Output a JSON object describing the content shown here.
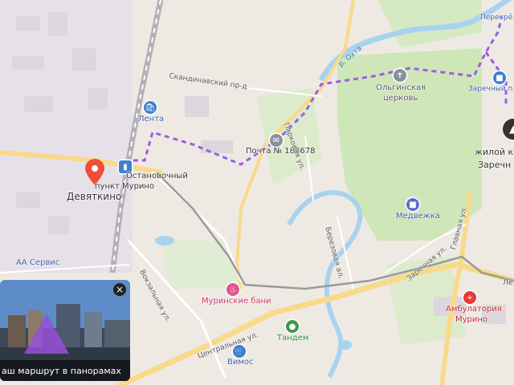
{
  "colors": {
    "land": "#eeeae3",
    "green": "#cfe6b8",
    "water": "#a8d3ef",
    "road_major": "#f9d98a",
    "route": "#9b5de5",
    "rail": "#8a8a8a"
  },
  "places": {
    "devyatkino": "Девяткино",
    "stop_murino_line1": "Остановочный",
    "stop_murino_line2": "пункт Мурино",
    "zhiloy_line1": "жилой к",
    "zhiloy_line2": "Заречн"
  },
  "pois": {
    "lenta": "Лента",
    "pochta": "Почта № 188678",
    "olginskaya_line1": "Ольгинская",
    "olginskaya_line2": "церковь",
    "medvezhka": "Медвежка",
    "murinskie_bani": "Муринские бани",
    "tandem": "Тандем",
    "vimos": "Вимос",
    "ambulatoriya_line1": "Амбулатория",
    "ambulatoriya_line2": "Мурино",
    "zarechny_shop": "Заречный п",
    "perekrestok": "Перекрё",
    "aa_servis": "АА Сервис"
  },
  "streets": {
    "skandinavsky": "Скандинавский пр-д",
    "parkovaya": "Парковая ул.",
    "berezovaya": "Березовая ал.",
    "zarechnaya": "Заречная ул.",
    "glavnaya": "Главная ул.",
    "vokzalnaya": "Вокзальная ул.",
    "tsentralnaya": "Центральная ул.",
    "len": "Ле"
  },
  "rivers": {
    "okhta": "р. Охта"
  },
  "panorama": {
    "caption": "аш маршрут в панорамах",
    "close_symbol": "×"
  },
  "icons": {
    "lenta": "shopping-bag-icon",
    "pochta": "mail-icon",
    "olginskaya": "church-cross-icon",
    "medvezhka": "bed-icon",
    "murinskie_bani": "bath-icon",
    "tandem": "sports-icon",
    "vimos": "shopping-cart-icon",
    "ambulatoriya": "medical-cross-icon",
    "zarechny_shop": "shop-icon",
    "stop_murino": "bus-icon",
    "location_pin": "map-pin-icon",
    "map_control": "compass-icon"
  }
}
